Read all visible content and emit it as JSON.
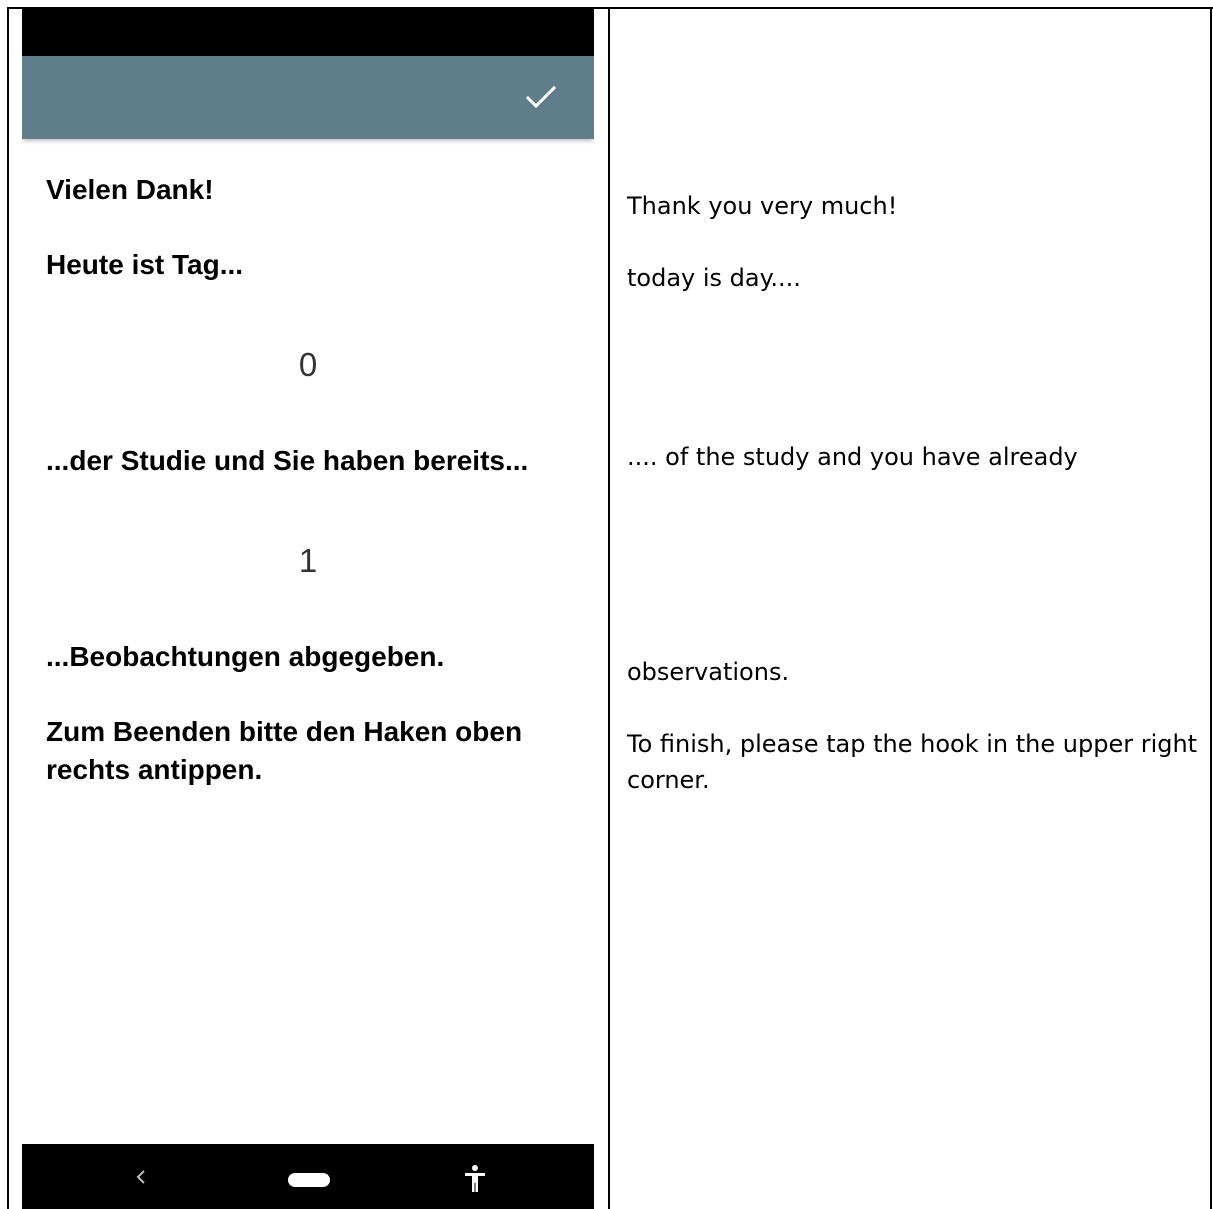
{
  "phone": {
    "app_bar": {
      "accent_color": "#607d8b",
      "confirm_icon": "check-icon"
    },
    "content": {
      "thanks": "Vielen Dank!",
      "today_is_day": "Heute ist Tag...",
      "day_number": "0",
      "study_text": "...der Studie und Sie haben bereits...",
      "observations_count": "1",
      "observations_text": "...Beobachtungen abgegeben.",
      "finish_instruction": "Zum Beenden bitte den Haken oben rechts antippen."
    },
    "nav_bar": {
      "back_icon": "chevron-left-icon",
      "home_icon": "home-pill-icon",
      "accessibility_icon": "accessibility-icon"
    }
  },
  "translation": {
    "thanks": "Thank you very much!",
    "today_is_day": "today is day....",
    "study_text": ".... of the study and you have already",
    "observations_text": "observations.",
    "finish_instruction": "To finish, please tap the hook in the upper right corner."
  }
}
